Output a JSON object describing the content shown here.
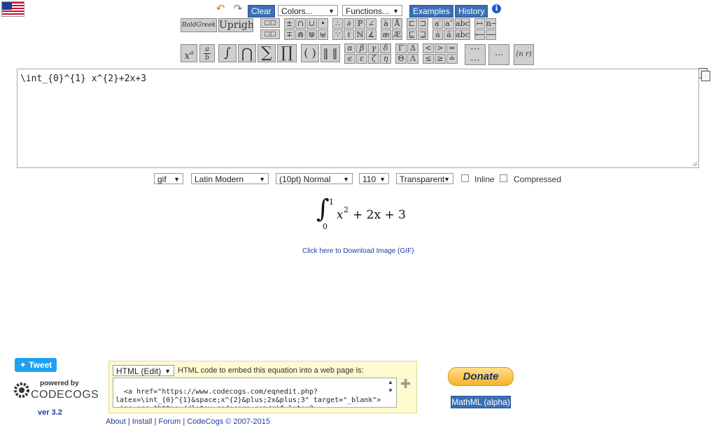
{
  "toolbar": {
    "clear_label": "Clear",
    "colors_label": "Colors...",
    "functions_label": "Functions...",
    "examples_label": "Examples",
    "history_label": "History",
    "info_symbol": "i",
    "undo_symbol": "↶",
    "redo_symbol": "↷"
  },
  "symbols": {
    "bold_green": "BoldGreek",
    "upright": "Upright",
    "superscript": "x",
    "superscript_exp": "a",
    "frac_num": "a",
    "frac_den": "b",
    "integral": "∫",
    "cap": "⋂",
    "sum": "∑",
    "product": "∏",
    "parens": "( )",
    "norm": "‖ ‖",
    "matrix_dots": "⋯",
    "binom": "(n r)",
    "greek_row1": [
      "α",
      "β",
      "γ",
      "δ",
      "Γ",
      "Δ",
      "<",
      ">",
      "="
    ],
    "greek_row2": [
      "ϵ",
      "ε",
      "ζ",
      "η",
      "Θ",
      "Λ",
      "≤",
      "≥",
      "≐"
    ],
    "ops_row1": [
      "±",
      "∩",
      "∪",
      "•",
      "∴",
      "∂",
      "ℙ",
      "∠",
      "à",
      "Å",
      "⊏",
      "⊐",
      "a′",
      "a″",
      "abc",
      "↦",
      "n→"
    ],
    "ops_row2": [
      "∓",
      "⋒",
      "⋓",
      "⊎",
      "∵",
      "ℓ",
      "ℕ",
      "∡",
      "æ",
      "Æ",
      "⊑",
      "⊒",
      "ȧ",
      "ä",
      "abc",
      "⟵",
      "⟶"
    ]
  },
  "editor": {
    "content": "\\int_{0}^{1} x^{2}+2x+3"
  },
  "options": {
    "format": "gif",
    "font": "Latin Modern",
    "size": "(10pt) Normal",
    "dpi": "110",
    "background": "Transparent",
    "inline_label": "Inline",
    "compressed_label": "Compressed"
  },
  "render": {
    "integral_sign": "∫",
    "upper_limit": "1",
    "lower_limit": "0",
    "expr_base": "x",
    "expr_exp": "2",
    "expr_rest": "+ 2x + 3"
  },
  "download_link": "Click here to Download Image (GIF)",
  "bottom": {
    "tweet_label": "Tweet",
    "powered_by": "powered by",
    "brand": "CODECOGS",
    "version": "ver 3.2",
    "embed_type": "HTML (Edit)",
    "embed_label": "HTML code to embed this equation into a web page is:",
    "embed_code": "<a href=\"https://www.codecogs.com/eqnedit.php?\nlatex=\\int_{0}^{1}&space;x^{2}&plus;2x&plus;3\" target=\"_blank\">\n<img src=\"https://latex.codecogs.com/gif.latex?",
    "donate_label": "Donate",
    "mathml_label": "MathML (alpha)"
  },
  "footer": {
    "about": "About",
    "install": "Install",
    "forum": "Forum",
    "copyright": "CodeCogs © 2007-2015",
    "sep": "|"
  }
}
